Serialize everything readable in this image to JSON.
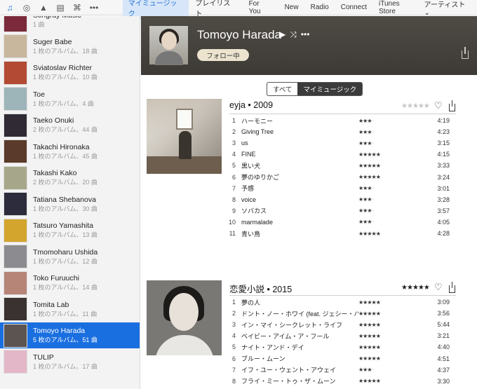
{
  "top_nav": {
    "items": [
      {
        "label": "マイミュージック",
        "active": true
      },
      {
        "label": "プレイリスト",
        "active": false
      },
      {
        "label": "For You",
        "active": false
      },
      {
        "label": "New",
        "active": false
      },
      {
        "label": "Radio",
        "active": false
      },
      {
        "label": "Connect",
        "active": false
      },
      {
        "label": "iTunes Store",
        "active": false
      }
    ],
    "view_menu": "アーティスト",
    "icons": [
      "music-note-icon",
      "podcast-icon",
      "itunes-u-icon",
      "book-icon",
      "radio-tower-icon",
      "more-icon"
    ]
  },
  "sidebar": {
    "artists": [
      {
        "name": "Stingray Music",
        "sub": "1 曲",
        "color": "#7a2a3a"
      },
      {
        "name": "Suger Babe",
        "sub": "1 枚のアルバム、18 曲",
        "color": "#c8b79c"
      },
      {
        "name": "Sviatoslav Richter",
        "sub": "1 枚のアルバム、10 曲",
        "color": "#b34a34"
      },
      {
        "name": "Toe",
        "sub": "1 枚のアルバム、4 曲",
        "color": "#9db5b8"
      },
      {
        "name": "Taeko Onuki",
        "sub": "2 枚のアルバム、44 曲",
        "color": "#2f2a33"
      },
      {
        "name": "Takachi Hironaka",
        "sub": "1 枚のアルバム、45 曲",
        "color": "#5a3a2a"
      },
      {
        "name": "Takashi Kako",
        "sub": "2 枚のアルバム、20 曲",
        "color": "#a6a68a"
      },
      {
        "name": "Tatiana Shebanova",
        "sub": "1 枚のアルバム、30 曲",
        "color": "#2c2c3c"
      },
      {
        "name": "Tatsuro Yamashita",
        "sub": "1 枚のアルバム、13 曲",
        "color": "#d3a52c"
      },
      {
        "name": "Tmomoharu Ushida",
        "sub": "1 枚のアルバム、12 曲",
        "color": "#8c8c90"
      },
      {
        "name": "Toko Furuuchi",
        "sub": "1 枚のアルバム、14 曲",
        "color": "#b78478"
      },
      {
        "name": "Tomita Lab",
        "sub": "1 枚のアルバム、11 曲",
        "color": "#3a3230"
      },
      {
        "name": "Tomoyo Harada",
        "sub": "5 枚のアルバム、51 曲",
        "color": "#5b5450",
        "selected": true
      },
      {
        "name": "TULIP",
        "sub": "1 枚のアルバム、17 曲",
        "color": "#e4b7c8"
      }
    ]
  },
  "header": {
    "artist": "Tomoyo Harada",
    "follow_label": "フォロー中",
    "play_icon": "▶",
    "shuffle_icon": "⤨",
    "more_icon": "•••"
  },
  "segment": {
    "all": "すべて",
    "mine": "マイミュージック"
  },
  "albums": [
    {
      "title": "eyja",
      "year": "2009",
      "rating": 0,
      "tracks": [
        {
          "n": "1",
          "name": "ハーモニー",
          "rating": 3,
          "dur": "4:19"
        },
        {
          "n": "2",
          "name": "Giving Tree",
          "rating": 3,
          "dur": "4:23"
        },
        {
          "n": "3",
          "name": "us",
          "rating": 3,
          "dur": "3:15"
        },
        {
          "n": "4",
          "name": "FINE",
          "rating": 5,
          "dur": "4:15"
        },
        {
          "n": "5",
          "name": "黒い犬",
          "rating": 5,
          "dur": "3:33"
        },
        {
          "n": "6",
          "name": "夢のゆりかご",
          "rating": 5,
          "dur": "3:24"
        },
        {
          "n": "7",
          "name": "予感",
          "rating": 3,
          "dur": "3:01"
        },
        {
          "n": "8",
          "name": "voice",
          "rating": 3,
          "dur": "3:28"
        },
        {
          "n": "9",
          "name": "ソバカス",
          "rating": 3,
          "dur": "3:57"
        },
        {
          "n": "10",
          "name": "marmalade",
          "rating": 3,
          "dur": "4:05"
        },
        {
          "n": "11",
          "name": "青い鳥",
          "rating": 5,
          "dur": "4:28"
        }
      ]
    },
    {
      "title": "恋愛小説",
      "year": "2015",
      "rating": 5,
      "tracks": [
        {
          "n": "1",
          "name": "夢の人",
          "rating": 5,
          "dur": "3:09"
        },
        {
          "n": "2",
          "name": "ドント・ノー・ホワイ (feat. ジェシー・ハリス)",
          "rating": 5,
          "dur": "3:56"
        },
        {
          "n": "3",
          "name": "イン・マイ・シークレット・ライフ",
          "rating": 5,
          "dur": "5:44"
        },
        {
          "n": "4",
          "name": "ベイビー・アイム・ア・フール",
          "rating": 5,
          "dur": "3:21"
        },
        {
          "n": "5",
          "name": "ナイト・アンド・デイ",
          "rating": 5,
          "dur": "4:40"
        },
        {
          "n": "6",
          "name": "ブルー・ムーン",
          "rating": 5,
          "dur": "4:51"
        },
        {
          "n": "7",
          "name": "イフ・ユー・ウェント・アウェイ",
          "rating": 3,
          "dur": "4:37"
        },
        {
          "n": "8",
          "name": "フライ・ミー・トゥ・ザ・ムーン",
          "rating": 5,
          "dur": "3:30"
        }
      ]
    }
  ]
}
